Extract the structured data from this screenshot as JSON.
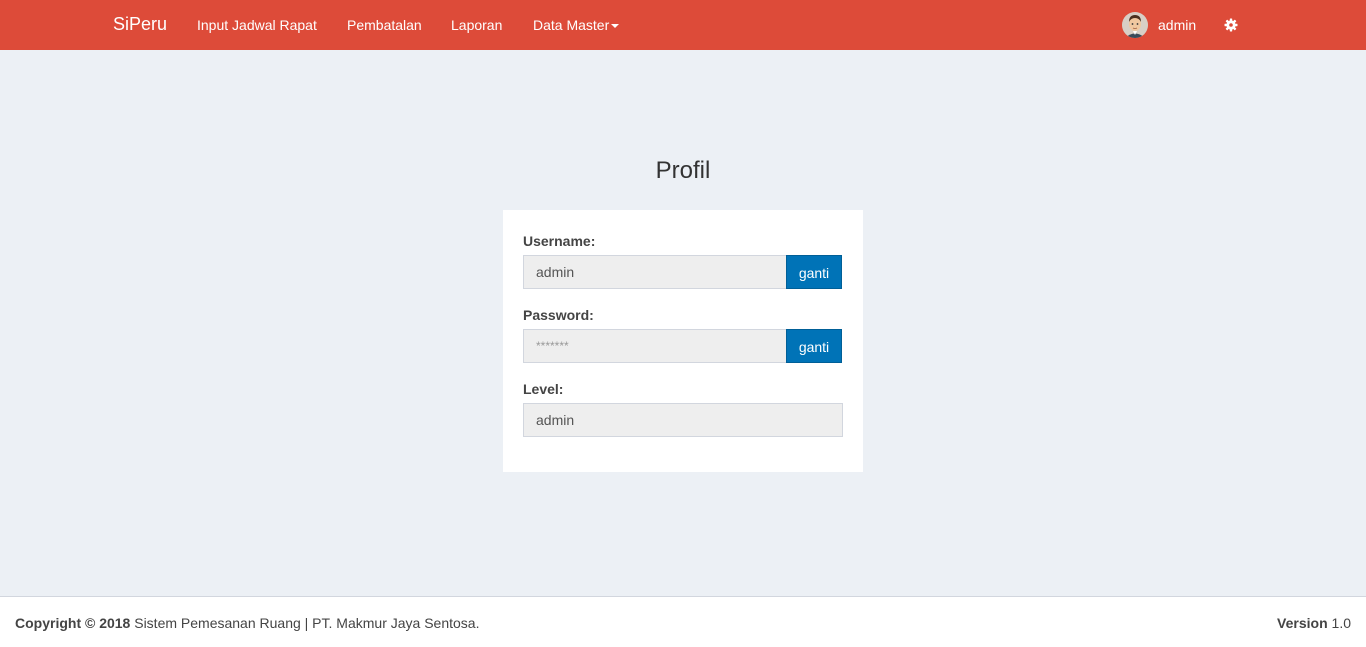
{
  "navbar": {
    "brand": "SiPeru",
    "items": [
      {
        "label": "Input Jadwal Rapat"
      },
      {
        "label": "Pembatalan"
      },
      {
        "label": "Laporan"
      },
      {
        "label": "Data Master"
      }
    ],
    "user_name": "admin",
    "accent_color": "#dd4b39"
  },
  "main": {
    "title": "Profil",
    "username": {
      "label": "Username:",
      "value": "admin",
      "button": "ganti"
    },
    "password": {
      "label": "Password:",
      "value": "*******",
      "button": "ganti"
    },
    "level": {
      "label": "Level:",
      "value": "admin"
    }
  },
  "footer": {
    "copyright_bold": "Copyright © 2018",
    "copyright_text": " Sistem Pemesanan Ruang | PT. Makmur Jaya Sentosa.",
    "version_label": "Version",
    "version_value": " 1.0"
  }
}
